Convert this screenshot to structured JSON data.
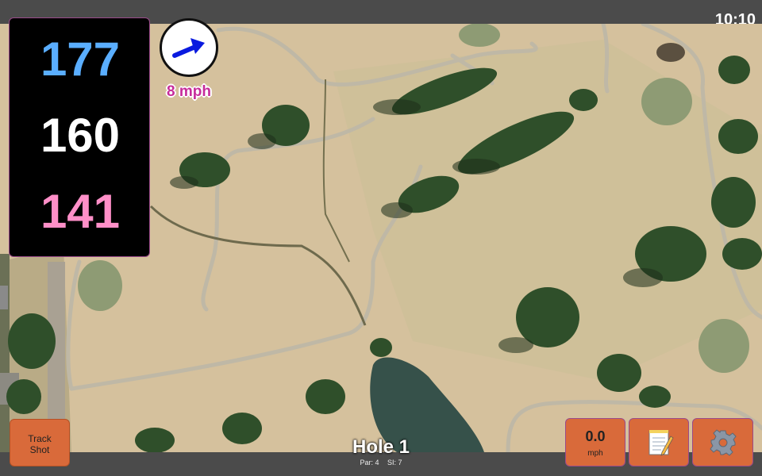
{
  "status": {
    "time": "10:10"
  },
  "distances": {
    "back": "177",
    "center": "160",
    "front": "141"
  },
  "wind": {
    "speed_label": "8 mph",
    "direction_icon": "arrow-icon"
  },
  "hole": {
    "title": "Hole 1",
    "par_label": "Par: 4",
    "si_label": "SI: 7"
  },
  "buttons": {
    "track_shot_line1": "Track",
    "track_shot_line2": "Shot",
    "speed_value": "0.0",
    "speed_unit": "mph",
    "notes_icon": "notepad-icon",
    "settings_icon": "gear-icon"
  },
  "colors": {
    "back_distance": "#5aaeff",
    "center_distance": "#ffffff",
    "front_distance": "#ff8fc8",
    "wind_text": "#c62c9b",
    "button_orange": "#d96a3a"
  }
}
